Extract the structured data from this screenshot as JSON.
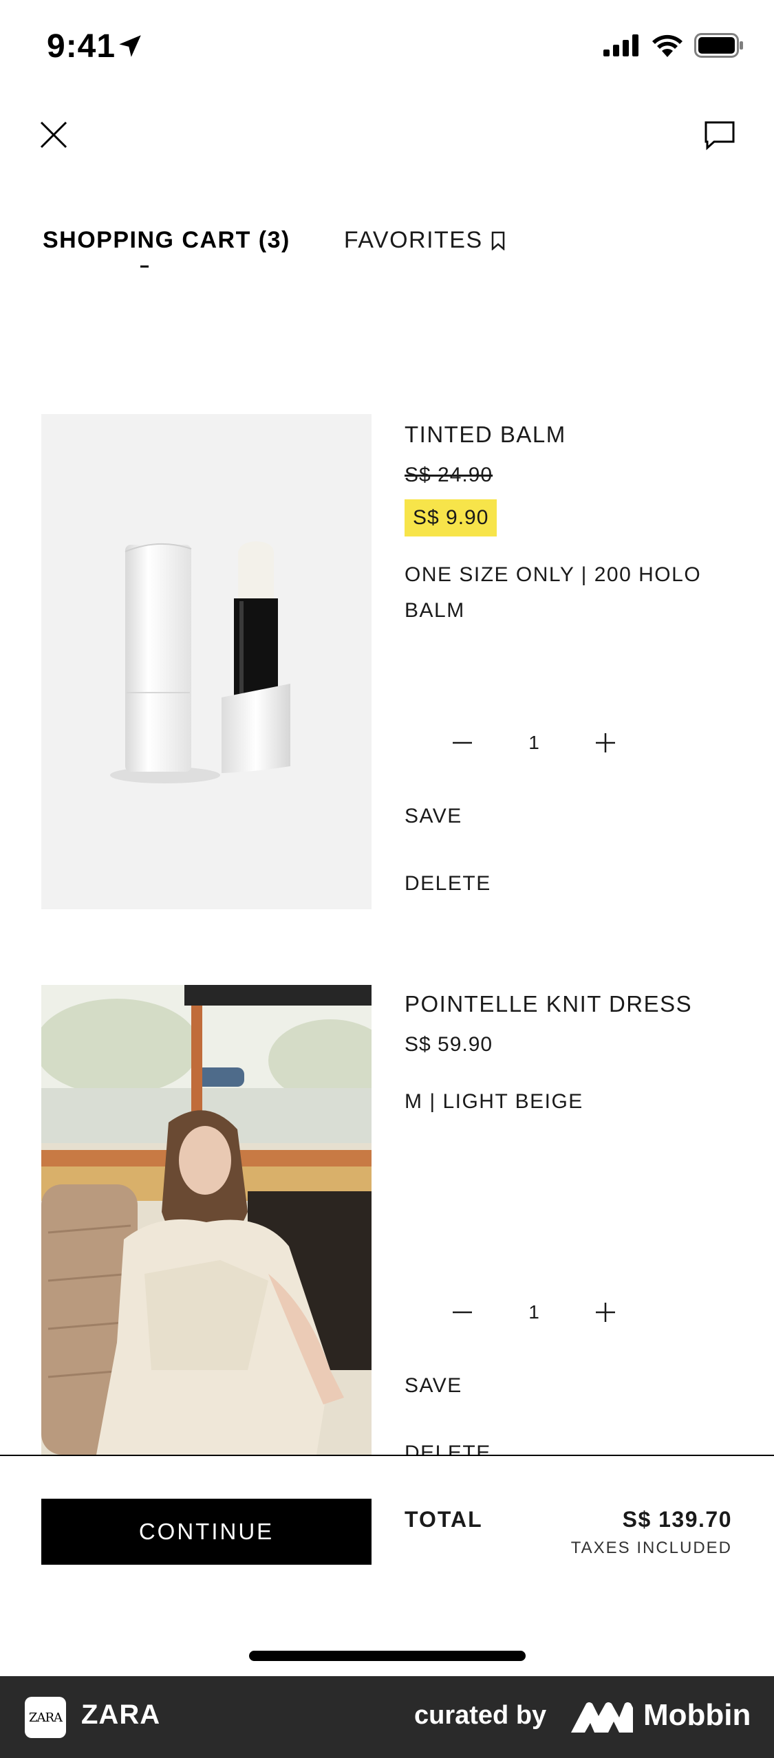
{
  "status": {
    "time": "9:41"
  },
  "tabs": [
    {
      "label": "SHOPPING CART (3)",
      "active": true
    },
    {
      "label": "FAVORITES",
      "active": false
    }
  ],
  "items": [
    {
      "name": "TINTED BALM",
      "original_price": "S$ 24.90",
      "sale_price": "S$ 9.90",
      "variant": "ONE SIZE ONLY | 200 HOLO BALM",
      "quantity": "1",
      "save_label": "SAVE",
      "delete_label": "DELETE"
    },
    {
      "name": "POINTELLE KNIT DRESS",
      "price": "S$ 59.90",
      "variant": "M | LIGHT BEIGE",
      "quantity": "1",
      "save_label": "SAVE",
      "delete_label": "DELETE"
    }
  ],
  "footer": {
    "continue_label": "CONTINUE",
    "total_label": "TOTAL",
    "total_value": "S$ 139.70",
    "taxes_note": "TAXES INCLUDED"
  },
  "brand_bar": {
    "logo_text": "ZARA",
    "app_name": "ZARA",
    "curated_by": "curated by",
    "mobbin": "Mobbin"
  },
  "colors": {
    "sale_highlight": "#f7e44a",
    "button_bg": "#000000",
    "brand_bar_bg": "#2a2a2a"
  }
}
